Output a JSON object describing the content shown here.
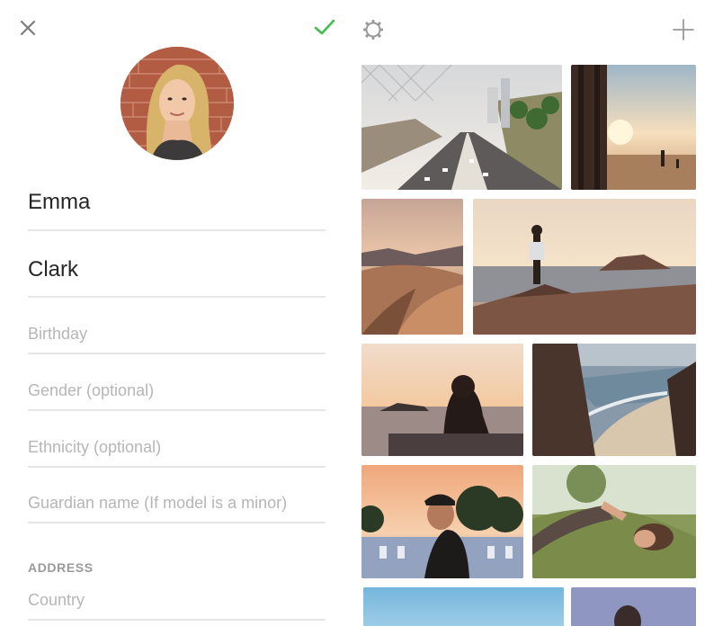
{
  "form": {
    "first_name": "Emma",
    "last_name": "Clark",
    "birthday_placeholder": "Birthday",
    "gender_placeholder": "Gender (optional)",
    "ethnicity_placeholder": "Ethnicity (optional)",
    "guardian_placeholder": "Guardian name (If model is a minor)",
    "address_label": "ADDRESS",
    "country_placeholder": "Country"
  },
  "icons": {
    "close": "close-icon",
    "confirm": "checkmark-icon",
    "settings": "gear-icon",
    "add": "plus-icon"
  },
  "colors": {
    "confirm": "#3fbf4d",
    "icon": "#8a8a8a",
    "divider": "#e6e6e6",
    "placeholder": "#b6b6b6"
  },
  "photos": [
    {
      "subject": "highway-city"
    },
    {
      "subject": "beach-pier-sunset"
    },
    {
      "subject": "desert-dunes"
    },
    {
      "subject": "person-on-rocks-ocean"
    },
    {
      "subject": "woman-sunset-sea"
    },
    {
      "subject": "coastal-cliffs"
    },
    {
      "subject": "man-with-cap"
    },
    {
      "subject": "woman-lying-grass"
    },
    {
      "subject": "blue-sky"
    },
    {
      "subject": "person-portrait-blue"
    }
  ]
}
